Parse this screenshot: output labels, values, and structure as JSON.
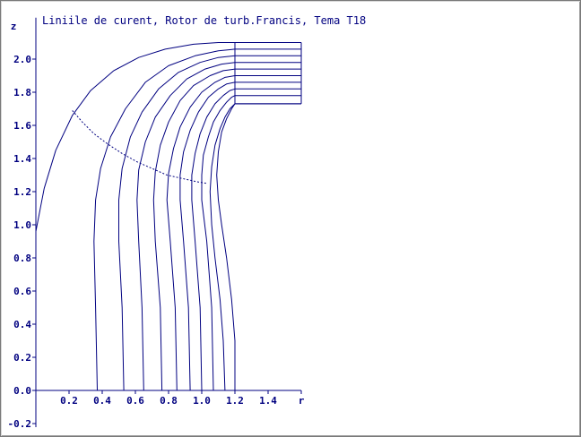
{
  "colors": {
    "ink": "#000080",
    "background": "#ffffff"
  },
  "chart_data": {
    "type": "line",
    "title": "Liniile de curent, Rotor de turb.Francis, Tema T18",
    "xlabel": "r",
    "ylabel": "z",
    "xlim": [
      0,
      1.6
    ],
    "ylim": [
      -0.2,
      2.25
    ],
    "grid": false,
    "x_ticks": [
      0.2,
      0.4,
      0.6,
      0.8,
      1.0,
      1.2,
      1.4
    ],
    "x_tick_labels": [
      "0.2",
      "0.4",
      "0.6",
      "0.8",
      "1.0",
      "1.2",
      "1.4"
    ],
    "y_ticks": [
      -0.2,
      0.0,
      0.2,
      0.4,
      0.6,
      0.8,
      1.0,
      1.2,
      1.4,
      1.6,
      1.8,
      2.0
    ],
    "y_tick_labels": [
      "-0.2",
      "0.0",
      "0.2",
      "0.4",
      "0.6",
      "0.8",
      "1.0",
      "1.2",
      "1.4",
      "1.6",
      "1.8",
      "2.0"
    ],
    "series": [
      {
        "points": [
          [
            0.0,
            0.96
          ],
          [
            0.05,
            1.22
          ],
          [
            0.12,
            1.45
          ],
          [
            0.22,
            1.66
          ],
          [
            0.33,
            1.81
          ],
          [
            0.47,
            1.93
          ],
          [
            0.62,
            2.01
          ],
          [
            0.78,
            2.06
          ],
          [
            0.95,
            2.09
          ],
          [
            1.1,
            2.1
          ],
          [
            1.2,
            2.1
          ],
          [
            1.6,
            2.1
          ]
        ]
      },
      {
        "points": [
          [
            0.37,
            0.0
          ],
          [
            0.36,
            0.5
          ],
          [
            0.35,
            0.9
          ],
          [
            0.36,
            1.15
          ],
          [
            0.39,
            1.34
          ],
          [
            0.45,
            1.53
          ],
          [
            0.54,
            1.7
          ],
          [
            0.66,
            1.86
          ],
          [
            0.8,
            1.96
          ],
          [
            0.96,
            2.02
          ],
          [
            1.1,
            2.05
          ],
          [
            1.2,
            2.06
          ],
          [
            1.6,
            2.06
          ]
        ]
      },
      {
        "points": [
          [
            0.53,
            0.0
          ],
          [
            0.52,
            0.5
          ],
          [
            0.5,
            0.9
          ],
          [
            0.5,
            1.15
          ],
          [
            0.52,
            1.34
          ],
          [
            0.57,
            1.53
          ],
          [
            0.64,
            1.68
          ],
          [
            0.74,
            1.82
          ],
          [
            0.86,
            1.92
          ],
          [
            0.99,
            1.98
          ],
          [
            1.1,
            2.01
          ],
          [
            1.2,
            2.02
          ],
          [
            1.6,
            2.02
          ]
        ]
      },
      {
        "points": [
          [
            0.65,
            0.0
          ],
          [
            0.64,
            0.5
          ],
          [
            0.62,
            0.9
          ],
          [
            0.61,
            1.15
          ],
          [
            0.62,
            1.33
          ],
          [
            0.66,
            1.5
          ],
          [
            0.72,
            1.65
          ],
          [
            0.81,
            1.78
          ],
          [
            0.91,
            1.88
          ],
          [
            1.02,
            1.94
          ],
          [
            1.12,
            1.97
          ],
          [
            1.2,
            1.98
          ],
          [
            1.6,
            1.98
          ]
        ]
      },
      {
        "points": [
          [
            0.76,
            0.0
          ],
          [
            0.75,
            0.5
          ],
          [
            0.72,
            0.9
          ],
          [
            0.71,
            1.15
          ],
          [
            0.72,
            1.32
          ],
          [
            0.75,
            1.48
          ],
          [
            0.8,
            1.62
          ],
          [
            0.87,
            1.75
          ],
          [
            0.95,
            1.84
          ],
          [
            1.05,
            1.9
          ],
          [
            1.13,
            1.93
          ],
          [
            1.2,
            1.94
          ],
          [
            1.6,
            1.94
          ]
        ]
      },
      {
        "points": [
          [
            0.85,
            0.0
          ],
          [
            0.84,
            0.5
          ],
          [
            0.81,
            0.9
          ],
          [
            0.79,
            1.15
          ],
          [
            0.8,
            1.31
          ],
          [
            0.83,
            1.46
          ],
          [
            0.87,
            1.59
          ],
          [
            0.93,
            1.71
          ],
          [
            1.0,
            1.8
          ],
          [
            1.08,
            1.86
          ],
          [
            1.14,
            1.89
          ],
          [
            1.2,
            1.9
          ],
          [
            1.6,
            1.9
          ]
        ]
      },
      {
        "points": [
          [
            0.93,
            0.0
          ],
          [
            0.92,
            0.5
          ],
          [
            0.89,
            0.9
          ],
          [
            0.87,
            1.15
          ],
          [
            0.87,
            1.3
          ],
          [
            0.89,
            1.44
          ],
          [
            0.93,
            1.57
          ],
          [
            0.98,
            1.68
          ],
          [
            1.04,
            1.77
          ],
          [
            1.1,
            1.82
          ],
          [
            1.15,
            1.85
          ],
          [
            1.2,
            1.86
          ],
          [
            1.6,
            1.86
          ]
        ]
      },
      {
        "points": [
          [
            1.0,
            0.0
          ],
          [
            0.99,
            0.5
          ],
          [
            0.96,
            0.9
          ],
          [
            0.94,
            1.15
          ],
          [
            0.94,
            1.3
          ],
          [
            0.96,
            1.43
          ],
          [
            0.99,
            1.55
          ],
          [
            1.03,
            1.65
          ],
          [
            1.08,
            1.73
          ],
          [
            1.13,
            1.78
          ],
          [
            1.17,
            1.81
          ],
          [
            1.2,
            1.82
          ],
          [
            1.6,
            1.82
          ]
        ]
      },
      {
        "points": [
          [
            1.07,
            0.0
          ],
          [
            1.06,
            0.5
          ],
          [
            1.03,
            0.9
          ],
          [
            1.0,
            1.15
          ],
          [
            1.0,
            1.3
          ],
          [
            1.01,
            1.42
          ],
          [
            1.04,
            1.53
          ],
          [
            1.07,
            1.62
          ],
          [
            1.11,
            1.69
          ],
          [
            1.15,
            1.74
          ],
          [
            1.18,
            1.77
          ],
          [
            1.2,
            1.78
          ],
          [
            1.6,
            1.78
          ]
        ]
      },
      {
        "points": [
          [
            1.14,
            0.0
          ],
          [
            1.13,
            0.3
          ],
          [
            1.11,
            0.55
          ],
          [
            1.08,
            0.8
          ],
          [
            1.06,
            1.0
          ],
          [
            1.05,
            1.2
          ],
          [
            1.06,
            1.35
          ],
          [
            1.08,
            1.48
          ],
          [
            1.11,
            1.58
          ],
          [
            1.14,
            1.65
          ],
          [
            1.17,
            1.7
          ],
          [
            1.2,
            1.73
          ],
          [
            1.6,
            1.73
          ]
        ]
      },
      {
        "points": [
          [
            1.2,
            0.0
          ],
          [
            1.2,
            0.3
          ],
          [
            1.18,
            0.55
          ],
          [
            1.15,
            0.8
          ],
          [
            1.12,
            1.0
          ],
          [
            1.1,
            1.15
          ],
          [
            1.09,
            1.3
          ],
          [
            1.1,
            1.44
          ],
          [
            1.12,
            1.56
          ],
          [
            1.15,
            1.64
          ],
          [
            1.18,
            1.7
          ],
          [
            1.2,
            1.73
          ],
          [
            1.6,
            1.73
          ]
        ]
      },
      {
        "points": [
          [
            1.2,
            1.73
          ],
          [
            1.2,
            2.1
          ]
        ]
      },
      {
        "points": [
          [
            1.6,
            1.73
          ],
          [
            1.6,
            2.1
          ]
        ]
      }
    ],
    "dashed_line": {
      "points": [
        [
          0.22,
          1.69
        ],
        [
          0.28,
          1.62
        ],
        [
          0.35,
          1.55
        ],
        [
          0.43,
          1.49
        ],
        [
          0.52,
          1.43
        ],
        [
          0.61,
          1.38
        ],
        [
          0.7,
          1.34
        ],
        [
          0.79,
          1.3
        ],
        [
          0.88,
          1.28
        ],
        [
          0.97,
          1.26
        ],
        [
          1.03,
          1.25
        ]
      ]
    }
  }
}
